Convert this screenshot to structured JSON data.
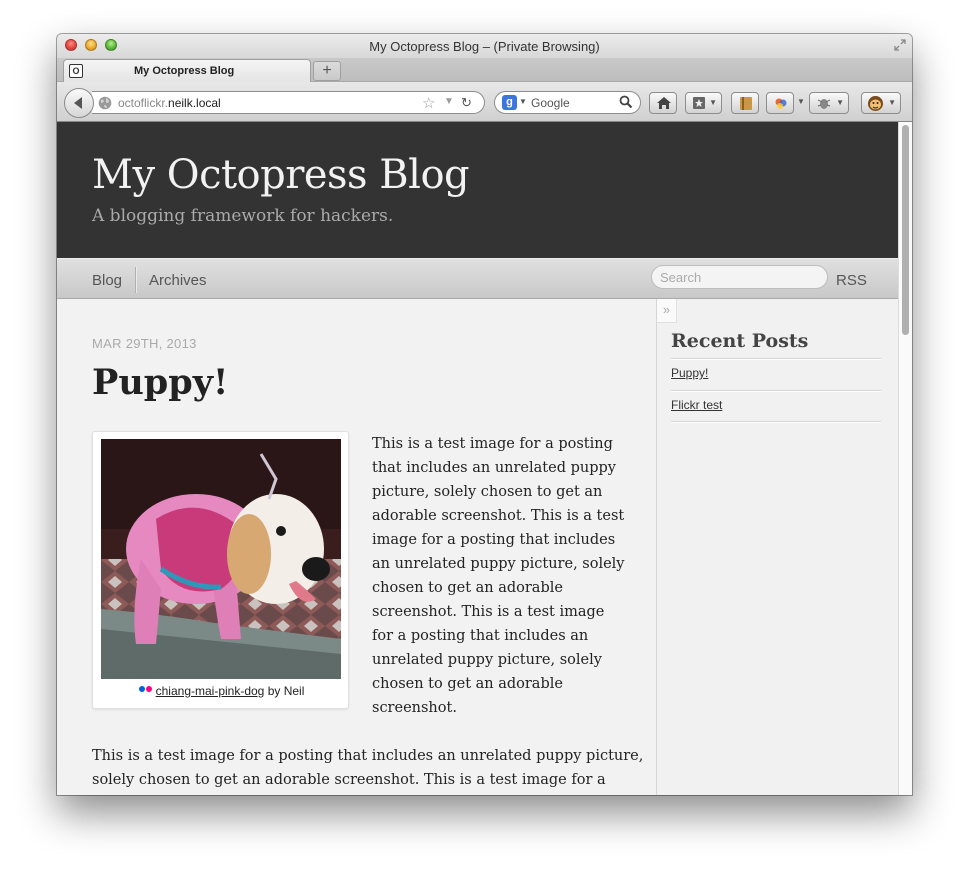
{
  "window": {
    "title": "My Octopress Blog – (Private Browsing)"
  },
  "tabs": [
    {
      "favicon": "O",
      "label": "My Octopress Blog"
    }
  ],
  "new_tab_label": "+",
  "navbar": {
    "url_prefix": "octoflickr.",
    "url_domain": "neilk.local",
    "search_engine": "Google",
    "search_engine_letter": "g"
  },
  "icons": {
    "back": "back-arrow-icon",
    "globe": "globe-icon",
    "bookmark_star": "star-icon",
    "reload": "reload-icon",
    "search": "magnifier-icon",
    "home": "home-icon",
    "bookmarks": "bookmarks-icon",
    "addon1": "notebook-icon",
    "addon2": "color-wheel-icon",
    "addon3": "bug-icon",
    "addon4": "monkey-icon"
  },
  "blog": {
    "title": "My Octopress Blog",
    "subtitle": "A blogging framework for hackers.",
    "nav": {
      "blog": "Blog",
      "archives": "Archives",
      "search_placeholder": "Search",
      "rss": "RSS"
    }
  },
  "post": {
    "date": "MAR 29TH, 2013",
    "title": "Puppy!",
    "photo_caption_link": "chiang-mai-pink-dog",
    "photo_caption_suffix": " by Neil",
    "float_text": "This is a test image for a posting that includes an unrelated puppy picture, solely chosen to get an adorable screenshot. This is a test image for a posting that includes an unrelated puppy picture, solely chosen to get an adorable screenshot. This is a test image for a posting that includes an unrelated puppy picture, solely chosen to get an adorable screenshot.",
    "full_text": "This is a test image for a posting that includes an unrelated puppy picture, solely chosen to get an adorable screenshot. This is a test image for a"
  },
  "sidebar": {
    "collapse_label": "»",
    "heading": "Recent Posts",
    "items": [
      {
        "label": "Puppy!"
      },
      {
        "label": "Flickr test"
      }
    ]
  }
}
